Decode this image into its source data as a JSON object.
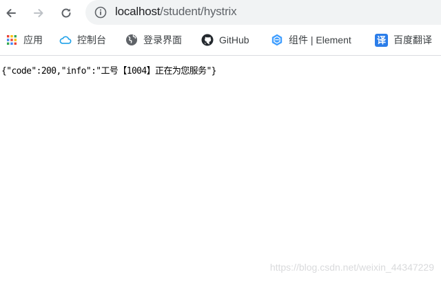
{
  "browser": {
    "url_host": "localhost",
    "url_path": "/student/hystrix",
    "icons": {
      "back": "arrow-left-icon",
      "forward": "arrow-right-icon",
      "reload": "reload-icon",
      "info": "info-icon"
    }
  },
  "bookmarks": [
    {
      "label": "应用",
      "icon": "apps-grid-icon"
    },
    {
      "label": "控制台",
      "icon": "cloud-icon"
    },
    {
      "label": "登录界面",
      "icon": "globe-icon"
    },
    {
      "label": "GitHub",
      "icon": "github-icon"
    },
    {
      "label": "组件 | Element",
      "icon": "element-icon"
    },
    {
      "label": "百度翻译",
      "icon": "translate-icon",
      "icon_text": "译"
    }
  ],
  "page": {
    "body_text": "{\"code\":200,\"info\":\"工号【1004】正在为您服务\"}"
  },
  "watermark": "https://blog.csdn.net/weixin_44347229",
  "colors": {
    "omnibox_bg": "#f1f3f4",
    "element_blue": "#409eff",
    "translate_blue": "#2b7de9",
    "cloud_blue": "#1ea1e9"
  }
}
